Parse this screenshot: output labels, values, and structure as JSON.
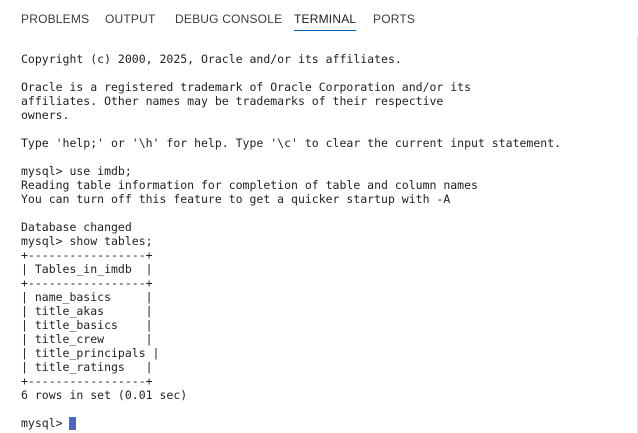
{
  "panel": {
    "tabs": [
      {
        "label": "PROBLEMS",
        "active": false
      },
      {
        "label": "OUTPUT",
        "active": false
      },
      {
        "label": "DEBUG CONSOLE",
        "active": false
      },
      {
        "label": "TERMINAL",
        "active": true
      },
      {
        "label": "PORTS",
        "active": false
      }
    ],
    "accent_color": "#005fb8"
  },
  "terminal": {
    "lines": [
      "Copyright (c) 2000, 2025, Oracle and/or its affiliates.",
      "",
      "Oracle is a registered trademark of Oracle Corporation and/or its",
      "affiliates. Other names may be trademarks of their respective",
      "owners.",
      "",
      "Type 'help;' or '\\h' for help. Type '\\c' to clear the current input statement.",
      "",
      "mysql> use imdb;",
      "Reading table information for completion of table and column names",
      "You can turn off this feature to get a quicker startup with -A",
      "",
      "Database changed",
      "mysql> show tables;",
      "+-----------------+",
      "| Tables_in_imdb  |",
      "+-----------------+",
      "| name_basics     |",
      "| title_akas      |",
      "| title_basics    |",
      "| title_crew      |",
      "| title_principals |",
      "| title_ratings   |",
      "+-----------------+",
      "6 rows in set (0.01 sec)",
      ""
    ],
    "prompt": "mysql> ",
    "cursor_color": "#4865c7"
  }
}
